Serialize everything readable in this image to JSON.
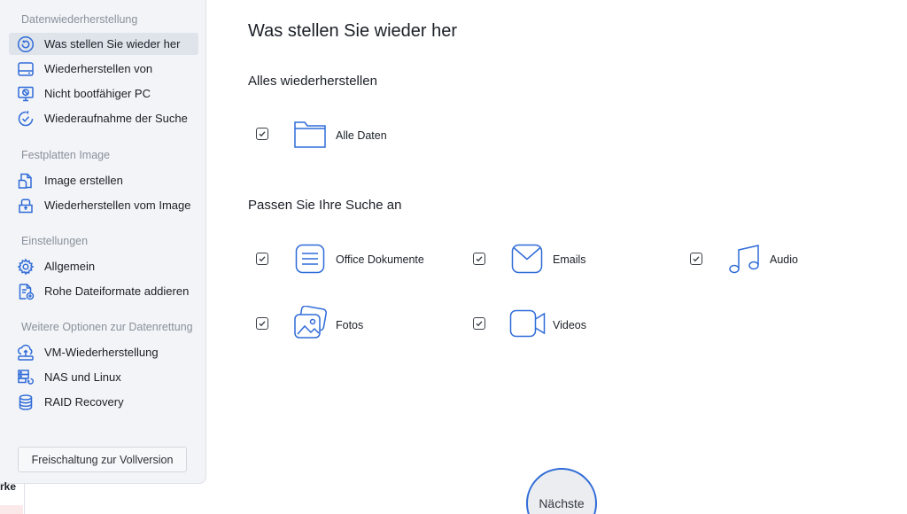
{
  "sidebar": {
    "sections": [
      {
        "title": "Datenwiederherstellung",
        "items": [
          {
            "label": "Was stellen Sie wieder her",
            "icon": "restore-icon",
            "active": true
          },
          {
            "label": "Wiederherstellen von",
            "icon": "drive-icon"
          },
          {
            "label": "Nicht bootfähiger PC",
            "icon": "monitor-blocked-icon"
          },
          {
            "label": "Wiederaufnahme der Suche",
            "icon": "resume-check-icon"
          }
        ]
      },
      {
        "title": "Festplatten Image",
        "items": [
          {
            "label": "Image erstellen",
            "icon": "image-create-icon"
          },
          {
            "label": "Wiederherstellen vom Image",
            "icon": "image-restore-icon"
          }
        ]
      },
      {
        "title": "Einstellungen",
        "items": [
          {
            "label": "Allgemein",
            "icon": "gear-icon"
          },
          {
            "label": "Rohe Dateiformate addieren",
            "icon": "file-add-icon"
          }
        ]
      },
      {
        "title": "Weitere Optionen zur Datenrettung",
        "items": [
          {
            "label": "VM-Wiederherstellung",
            "icon": "vm-restore-icon"
          },
          {
            "label": "NAS und Linux",
            "icon": "nas-icon"
          },
          {
            "label": "RAID Recovery",
            "icon": "database-icon"
          }
        ]
      }
    ],
    "unlock_label": "Freischaltung zur Vollversion"
  },
  "stub_text": "rke",
  "main": {
    "title": "Was stellen Sie wieder her",
    "all_section": {
      "title": "Alles wiederherstellen",
      "item": {
        "label": "Alle Daten",
        "icon": "folder-icon",
        "checked": true
      }
    },
    "custom_section": {
      "title": "Passen Sie Ihre Suche an",
      "items": [
        {
          "label": "Office Dokumente",
          "icon": "document-icon",
          "checked": true
        },
        {
          "label": "Emails",
          "icon": "mail-icon",
          "checked": true
        },
        {
          "label": "Audio",
          "icon": "music-icon",
          "checked": true
        },
        {
          "label": "Fotos",
          "icon": "photos-icon",
          "checked": true
        },
        {
          "label": "Videos",
          "icon": "video-icon",
          "checked": true
        }
      ]
    }
  },
  "next_label": "Nächste",
  "colors": {
    "accent": "#2f6bd8",
    "sidebar_bg": "#f2f4f7",
    "active_bg": "#dfe3ea"
  }
}
